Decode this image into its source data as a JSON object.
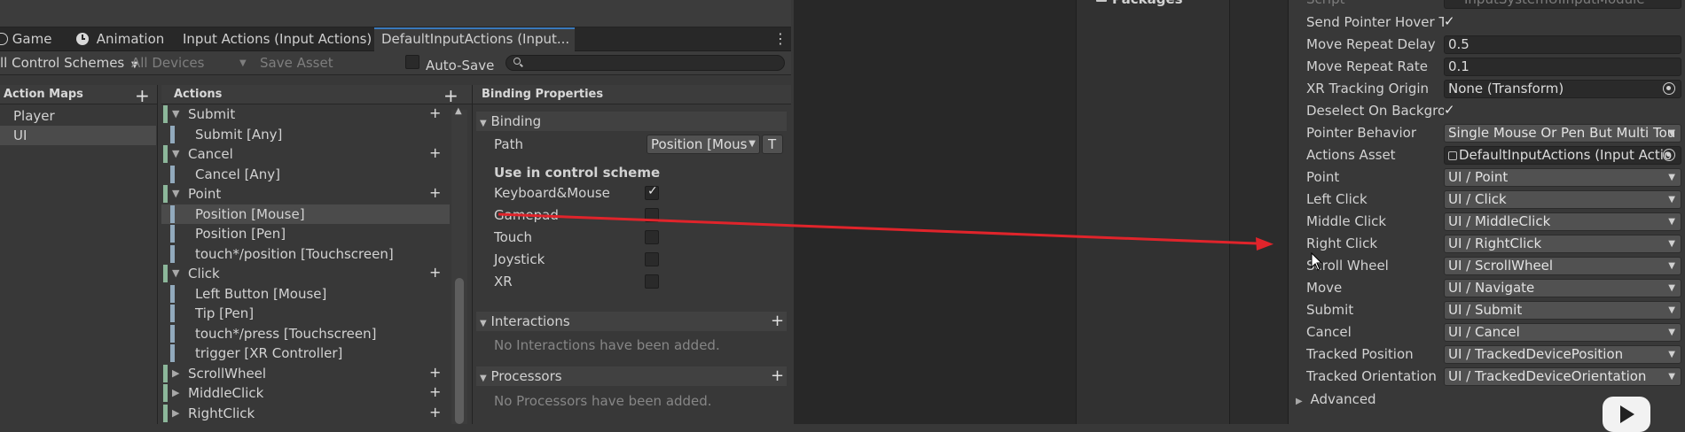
{
  "tabs": [
    {
      "label": "Game",
      "icon": "game-icon"
    },
    {
      "label": "Animation",
      "icon": "clock-icon"
    },
    {
      "label": "Input Actions (Input Actions)"
    },
    {
      "label": "DefaultInputActions (Input..."
    }
  ],
  "toolbar": {
    "control_schemes": "ll Control Schemes",
    "devices": "All Devices",
    "save_asset": "Save Asset",
    "auto_save": "Auto-Save"
  },
  "action_maps": {
    "header": "Action Maps",
    "items": [
      "Player",
      "UI"
    ]
  },
  "actions": {
    "header": "Actions",
    "rows": [
      {
        "label": "Submit",
        "kind": "action"
      },
      {
        "label": "Submit [Any]",
        "kind": "binding"
      },
      {
        "label": "Cancel",
        "kind": "action"
      },
      {
        "label": "Cancel [Any]",
        "kind": "binding"
      },
      {
        "label": "Point",
        "kind": "action"
      },
      {
        "label": "Position [Mouse]",
        "kind": "binding",
        "selected": true
      },
      {
        "label": "Position [Pen]",
        "kind": "binding"
      },
      {
        "label": "touch*/position [Touchscreen]",
        "kind": "binding"
      },
      {
        "label": "Click",
        "kind": "action"
      },
      {
        "label": "Left Button [Mouse]",
        "kind": "binding"
      },
      {
        "label": "Tip [Pen]",
        "kind": "binding"
      },
      {
        "label": "touch*/press [Touchscreen]",
        "kind": "binding"
      },
      {
        "label": "trigger [XR Controller]",
        "kind": "binding"
      },
      {
        "label": "ScrollWheel",
        "kind": "action-collapsed"
      },
      {
        "label": "MiddleClick",
        "kind": "action-collapsed"
      },
      {
        "label": "RightClick",
        "kind": "action-collapsed"
      }
    ]
  },
  "binding_properties": {
    "header": "Binding Properties",
    "binding_section": "Binding",
    "path_label": "Path",
    "path_value": "Position [Mous",
    "t_button": "T",
    "use_in_scheme": "Use in control scheme",
    "schemes": [
      {
        "label": "Keyboard&Mouse",
        "checked": true
      },
      {
        "label": "Gamepad",
        "checked": false
      },
      {
        "label": "Touch",
        "checked": false
      },
      {
        "label": "Joystick",
        "checked": false
      },
      {
        "label": "XR",
        "checked": false
      }
    ],
    "interactions_section": "Interactions",
    "interactions_empty": "No Interactions have been added.",
    "processors_section": "Processors",
    "processors_empty": "No Processors have been added."
  },
  "project": {
    "packages": "Packages"
  },
  "inspector": {
    "script_label": "Script",
    "script_value": "InputSystemUIInputModule",
    "rows": [
      {
        "label": "Send Pointer Hover T",
        "type": "check"
      },
      {
        "label": "Move Repeat Delay",
        "type": "field",
        "value": "0.5"
      },
      {
        "label": "Move Repeat Rate",
        "type": "field",
        "value": "0.1"
      },
      {
        "label": "XR Tracking Origin",
        "type": "object",
        "value": "None (Transform)"
      },
      {
        "label": "Deselect On Backgro",
        "type": "check"
      },
      {
        "label": "Pointer Behavior",
        "type": "dropdown",
        "value": "Single Mouse Or Pen But Multi Tou"
      },
      {
        "label": "Actions Asset",
        "type": "object",
        "value": "DefaultInputActions (Input Actio"
      },
      {
        "label": "Point",
        "type": "dropdown",
        "value": "UI / Point"
      },
      {
        "label": "Left Click",
        "type": "dropdown",
        "value": "UI / Click"
      },
      {
        "label": "Middle Click",
        "type": "dropdown",
        "value": "UI / MiddleClick"
      },
      {
        "label": "Right Click",
        "type": "dropdown",
        "value": "UI / RightClick"
      },
      {
        "label": "Scroll Wheel",
        "type": "dropdown",
        "value": "UI / ScrollWheel"
      },
      {
        "label": "Move",
        "type": "dropdown",
        "value": "UI / Navigate"
      },
      {
        "label": "Submit",
        "type": "dropdown",
        "value": "UI / Submit"
      },
      {
        "label": "Cancel",
        "type": "dropdown",
        "value": "UI / Cancel"
      },
      {
        "label": "Tracked Position",
        "type": "dropdown",
        "value": "UI / TrackedDevicePosition"
      },
      {
        "label": "Tracked Orientation",
        "type": "dropdown",
        "value": "UI / TrackedDeviceOrientation"
      }
    ],
    "advanced": "Advanced"
  },
  "colors": {
    "arrow": "#e0242b",
    "green_bar": "#8cb79a",
    "blue_bar": "#92aabd",
    "accent": "#3a79bb"
  }
}
